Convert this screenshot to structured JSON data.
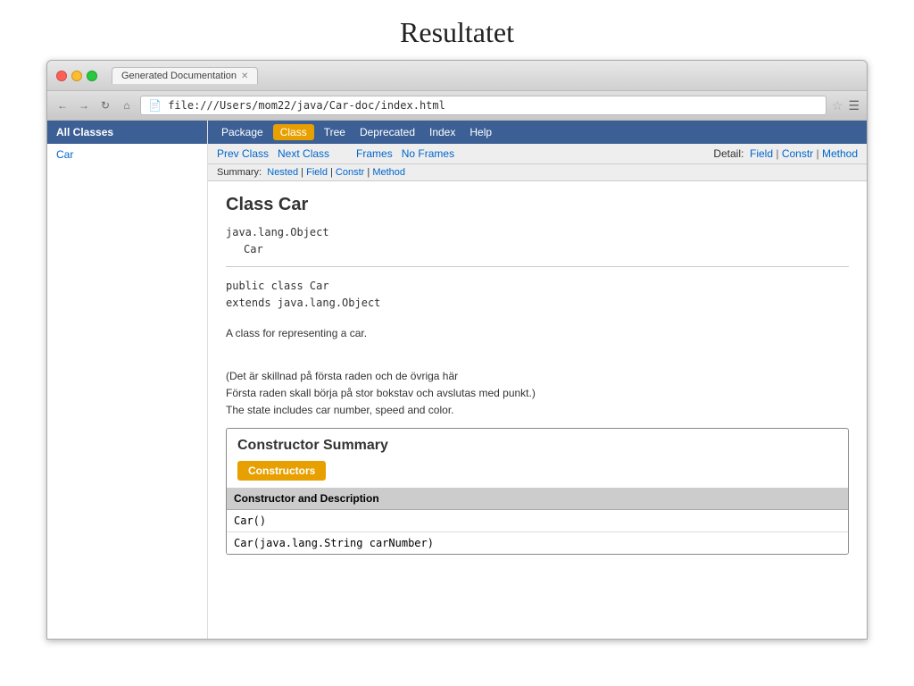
{
  "page": {
    "title": "Resultatet"
  },
  "browser": {
    "tab_title": "Generated Documentation",
    "address": "file:///Users/mom22/java/Car-doc/index.html"
  },
  "navbar": {
    "package_label": "Package",
    "class_label": "Class",
    "tree_label": "Tree",
    "deprecated_label": "Deprecated",
    "index_label": "Index",
    "help_label": "Help"
  },
  "subbar": {
    "prev_class": "Prev Class",
    "next_class": "Next Class",
    "frames": "Frames",
    "no_frames": "No Frames",
    "summary_label": "Summary:",
    "summary_nested": "Nested",
    "summary_field": "Field",
    "summary_constr": "Constr",
    "summary_method": "Method",
    "detail_label": "Detail:",
    "detail_field": "Field",
    "detail_constr": "Constr",
    "detail_method": "Method"
  },
  "sidebar": {
    "header": "All Classes",
    "items": [
      {
        "label": "Car"
      }
    ]
  },
  "class_doc": {
    "title": "Class Car",
    "hierarchy_parent": "java.lang.Object",
    "hierarchy_child": "Car",
    "signature_line1": "public class Car",
    "signature_line2": "extends java.lang.Object",
    "description1": "A class for representing a car.",
    "description2": "(Det är skillnad på första raden och de övriga här",
    "description3": "Första raden skall börja på stor bokstav och avslutas med punkt.)",
    "description4": "The state includes car number, speed and color."
  },
  "constructor_summary": {
    "title": "Constructor Summary",
    "tab_label": "Constructors",
    "table_header": "Constructor and Description",
    "constructors": [
      {
        "signature": "Car()"
      },
      {
        "signature": "Car(java.lang.String carNumber)"
      }
    ]
  }
}
